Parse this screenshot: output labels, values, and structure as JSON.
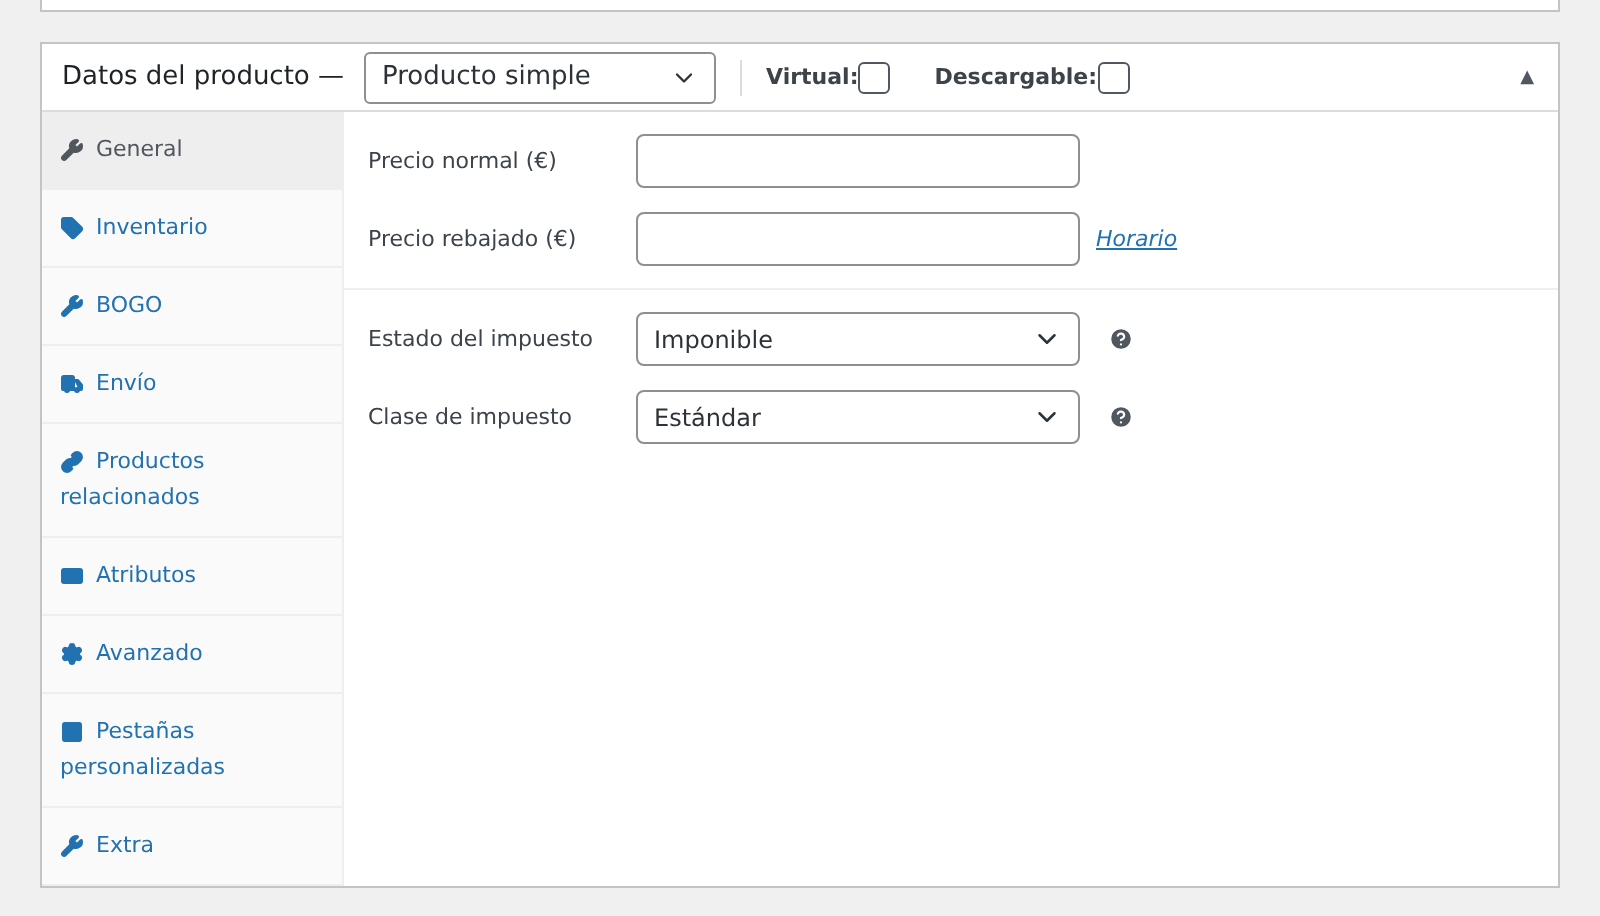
{
  "panel": {
    "title": "Datos del producto —",
    "product_type": "Producto simple",
    "options": [
      {
        "label": "Virtual:",
        "checked": false
      },
      {
        "label": "Descargable:",
        "checked": false
      }
    ],
    "collapse_icon": "▲"
  },
  "tabs": [
    {
      "label": "General",
      "selected": true
    },
    {
      "label": "Inventario",
      "selected": false
    },
    {
      "label": "BOGO",
      "selected": false
    },
    {
      "label": "Envío",
      "selected": false
    },
    {
      "label": "Productos relacionados",
      "selected": false
    },
    {
      "label": "Atributos",
      "selected": false
    },
    {
      "label": "Avanzado",
      "selected": false
    },
    {
      "label": "Pestañas personalizadas",
      "selected": false
    },
    {
      "label": "Extra",
      "selected": false
    }
  ],
  "groups": [
    [
      {
        "kind": "text",
        "label": "Precio normal (€)"
      },
      {
        "kind": "text",
        "label": "Precio rebajado (€)",
        "link": "Horario"
      }
    ],
    [
      {
        "kind": "select",
        "label": "Estado del impuesto",
        "value": "Imponible",
        "help": true
      },
      {
        "kind": "select",
        "label": "Clase de impuesto",
        "value": "Estándar",
        "help": true
      }
    ]
  ]
}
